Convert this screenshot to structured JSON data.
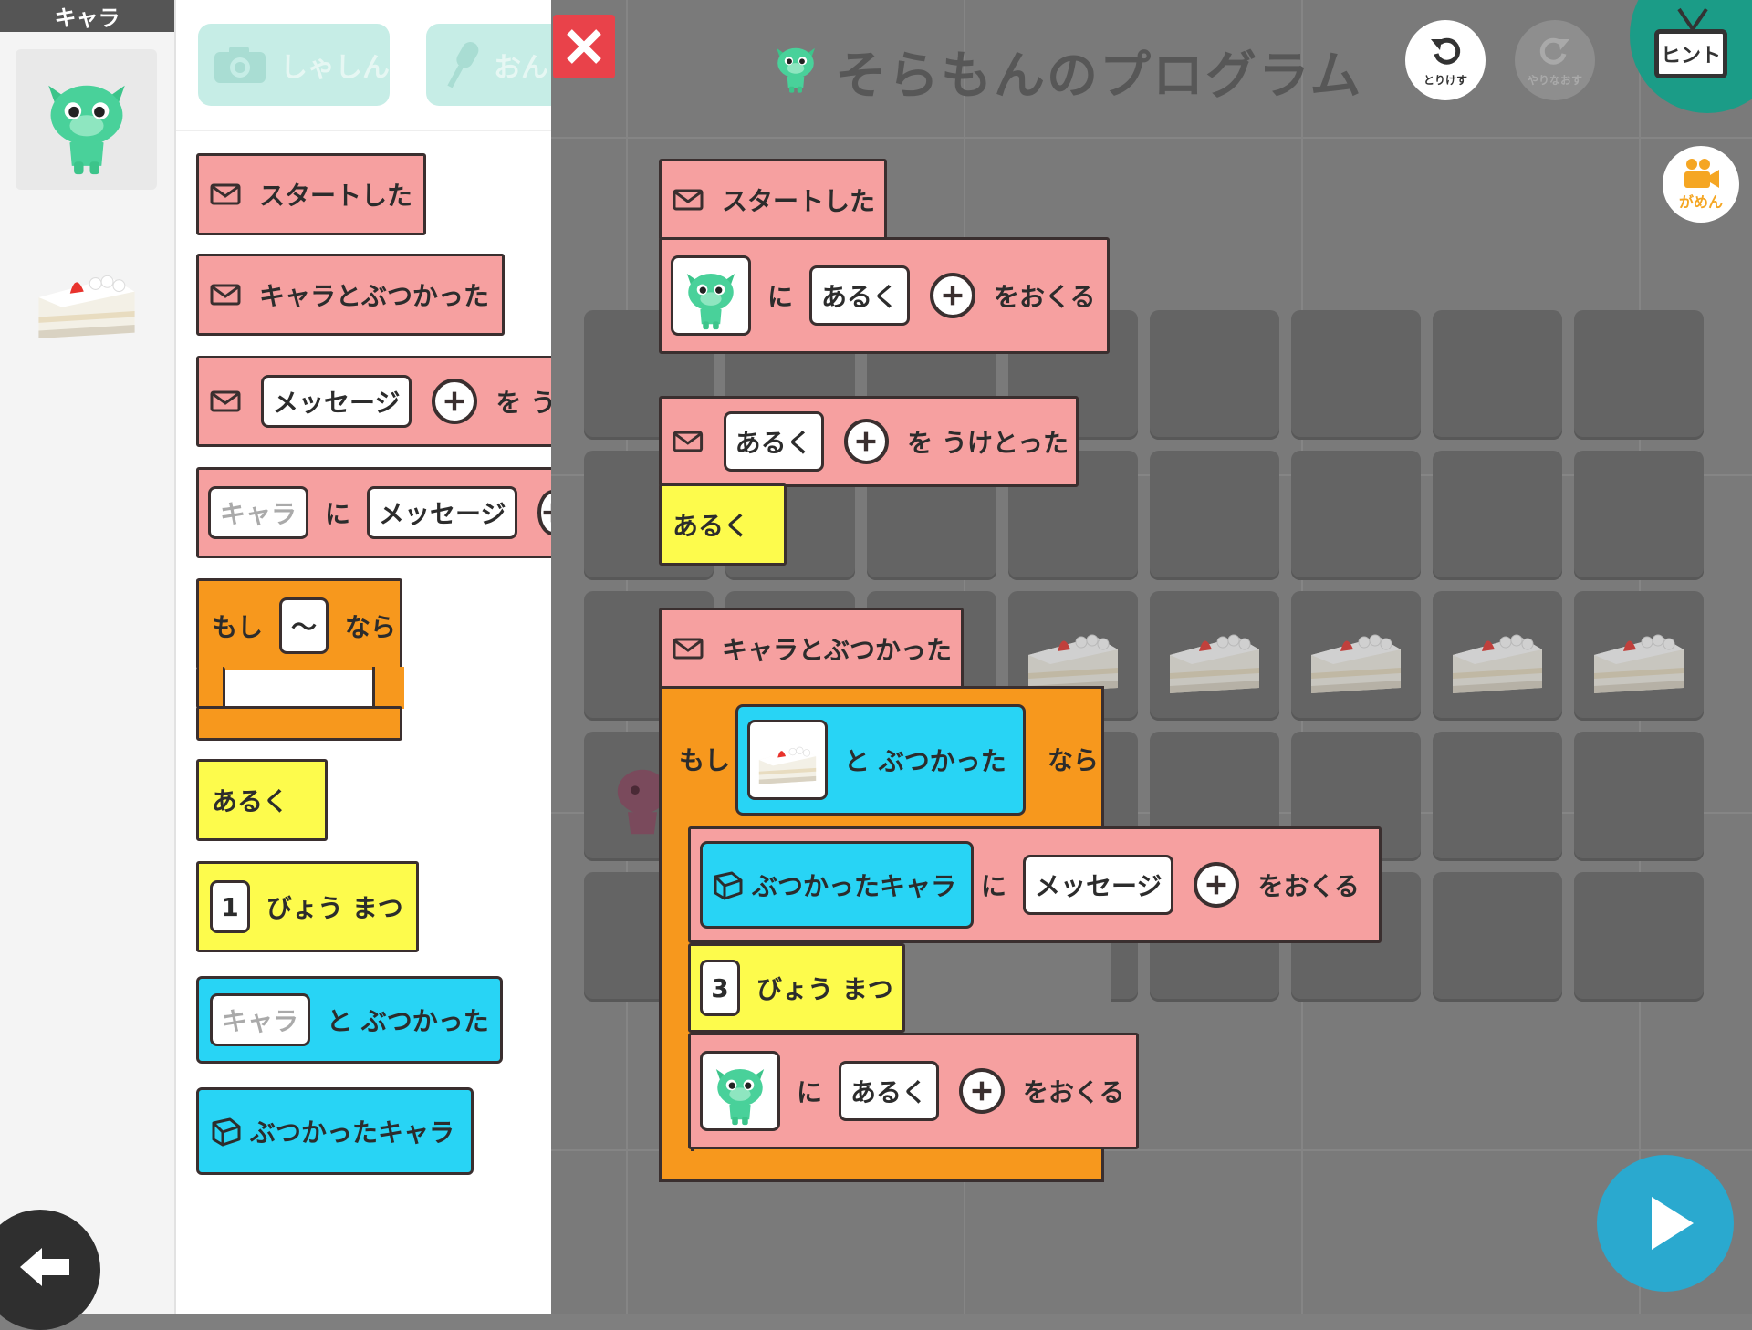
{
  "sidebar": {
    "header": "キャラ",
    "chars": [
      "sora-mon",
      "cake"
    ]
  },
  "palette": {
    "buttons": [
      {
        "label": "しゃしん",
        "icon": "camera-icon"
      },
      {
        "label": "おん",
        "icon": "microphone-icon"
      }
    ],
    "blocks": {
      "start": "スタートした",
      "collided": "キャラとぶつかった",
      "msg_recv_slot": "メッセージ",
      "msg_recv_after": "を う",
      "send_target": "キャラ",
      "send_ni": "に",
      "send_slot": "メッセージ",
      "if_mo": "もし",
      "if_cond": "～",
      "if_nara": "なら",
      "aruku": "あるく",
      "wait_num": "1",
      "wait_text": "びょう まつ",
      "touch_target": "キャラ",
      "touch_text": "と ぶつかった",
      "hit_char": "ぶつかったキャラ"
    }
  },
  "header": {
    "title": "そらもんのプログラム",
    "undo": "とりけす",
    "redo": "やりなおす",
    "hint": "ヒント",
    "screen": "がめん"
  },
  "program": {
    "start": "スタートした",
    "send1_ni": "に",
    "send1_msg": "あるく",
    "send1_after": "をおくる",
    "recv_msg": "あるく",
    "recv_after": "を うけとった",
    "recv_body": "あるく",
    "collided": "キャラとぶつかった",
    "if_mo": "もし",
    "if_touch": "と ぶつかった",
    "if_nara": "なら",
    "hit_char": "ぶつかったキャラ",
    "send2_ni": "に",
    "send2_msg": "メッセージ",
    "send2_after": "をおくる",
    "wait_num": "3",
    "wait_text": "びょう まつ",
    "send3_ni": "に",
    "send3_msg": "あるく",
    "send3_after": "をおくる"
  },
  "colors": {
    "event_block": "#f6a0a0",
    "control_block": "#f7981d",
    "action_block": "#fdfb4c",
    "sensing_block": "#28d4f5",
    "play_button": "#2aa9cf",
    "hint_button": "#1b9c87",
    "close_button": "#e9424a"
  }
}
